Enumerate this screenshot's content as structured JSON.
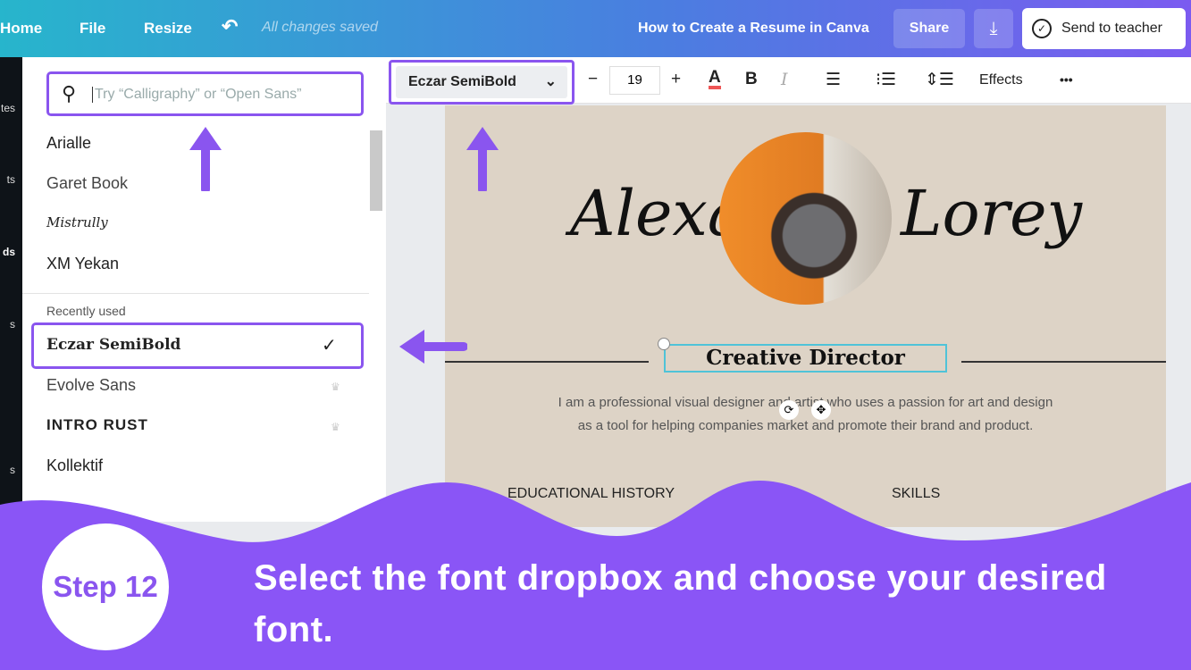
{
  "topbar": {
    "home": "Home",
    "file": "File",
    "resize": "Resize",
    "status": "All changes saved",
    "title": "How to Create a Resume in Canva",
    "share": "Share",
    "send": "Send to teacher"
  },
  "sidebar": {
    "labels": [
      "tes",
      "ts",
      "ds",
      "s",
      "s"
    ]
  },
  "font_panel": {
    "search_placeholder": "Try “Calligraphy” or “Open Sans”",
    "fonts": [
      "Arialle",
      "Garet Book",
      "Mistrully",
      "XM Yekan"
    ],
    "recent_heading": "Recently used",
    "recent": [
      "Eczar SemiBold",
      "Evolve Sans",
      "INTRO RUST",
      "Kollektif"
    ],
    "selected": "Eczar SemiBold"
  },
  "toolbar": {
    "font": "Eczar SemiBold",
    "size": "19",
    "minus": "−",
    "plus": "+",
    "bold": "B",
    "italic": "I",
    "effects": "Effects",
    "more": "•••"
  },
  "design": {
    "first": "Alexa",
    "last": "Lorey",
    "job": "Creative Director",
    "bio1": "I am a professional visual designer and artist who uses a passion for art and design",
    "bio2": "as a tool for helping companies market and promote their brand and product.",
    "edu": "EDUCATIONAL HISTORY",
    "skills": "SKILLS"
  },
  "tutorial": {
    "step": "Step 12",
    "caption": "Select the font dropbox and choose your desired font.",
    "accent": "#8a55f6"
  }
}
